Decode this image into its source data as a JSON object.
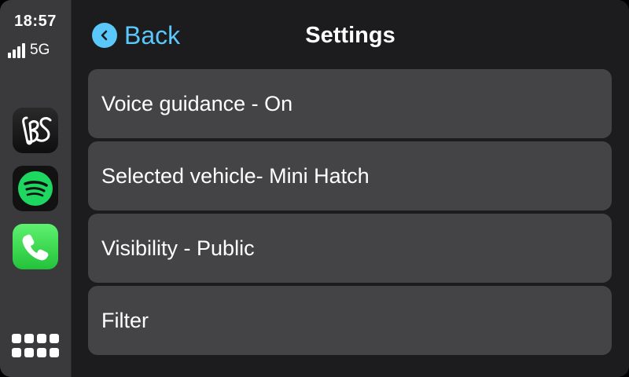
{
  "status": {
    "time": "18:57",
    "network": "5G",
    "signal_bars": 4
  },
  "sidebar": {
    "apps": [
      {
        "name": "BS",
        "icon": "bs-app-icon"
      },
      {
        "name": "Spotify",
        "icon": "spotify-icon",
        "color": "#1ed760"
      },
      {
        "name": "Phone",
        "icon": "phone-icon",
        "color": "#34c759"
      }
    ],
    "app_grid_icon": "app-grid-icon"
  },
  "header": {
    "back_label": "Back",
    "title": "Settings"
  },
  "settings": {
    "items": [
      {
        "label": "Voice guidance - On"
      },
      {
        "label": "Selected vehicle- Mini Hatch"
      },
      {
        "label": "Visibility - Public"
      },
      {
        "label": "Filter"
      }
    ]
  },
  "colors": {
    "accent": "#5ac8fa",
    "sidebar_bg": "#3a3a3c",
    "main_bg": "#1c1c1e",
    "row_bg": "#444446"
  }
}
